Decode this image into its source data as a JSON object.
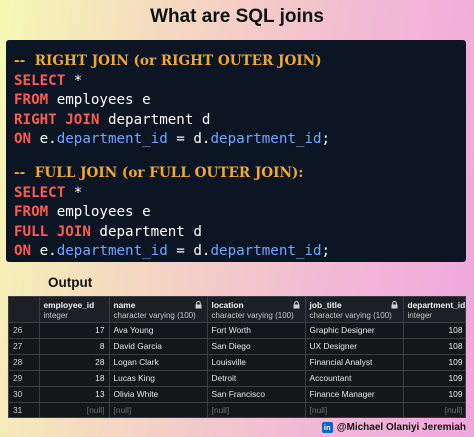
{
  "title": "What are SQL joins",
  "code": {
    "right_comment": "--  RIGHT JOIN (or RIGHT OUTER JOIN)",
    "right_select_kw": "SELECT",
    "right_select_rest": " *",
    "right_from_kw": "FROM",
    "right_from_rest": " employees e",
    "right_join_kw": "RIGHT JOIN",
    "right_join_rest": " department d",
    "right_on_kw": "ON",
    "right_on_e": " e.",
    "right_on_col1": "department_id",
    "right_on_mid": " = d.",
    "right_on_col2": "department_id",
    "right_on_end": ";",
    "full_comment": "--  FULL JOIN (or FULL OUTER JOIN):",
    "full_select_kw": "SELECT",
    "full_select_rest": " *",
    "full_from_kw": "FROM",
    "full_from_rest": " employees e",
    "full_join_kw": "FULL JOIN",
    "full_join_rest": " department d",
    "full_on_kw": "ON",
    "full_on_e": " e.",
    "full_on_col1": "department_id",
    "full_on_mid": " = d.",
    "full_on_col2": "department_id",
    "full_on_end": ";"
  },
  "output_label": "Output",
  "table": {
    "headers": [
      {
        "name": "",
        "type": ""
      },
      {
        "name": "employee_id",
        "type": "integer"
      },
      {
        "name": "name",
        "type": "character varying (100)"
      },
      {
        "name": "location",
        "type": "character varying (100)"
      },
      {
        "name": "job_title",
        "type": "character varying (100)"
      },
      {
        "name": "department_id",
        "type": "integer"
      }
    ],
    "rows": [
      {
        "row": "26",
        "employee_id": "17",
        "name": "Ava Young",
        "location": "Fort Worth",
        "job_title": "Graphic Designer",
        "department_id": "108"
      },
      {
        "row": "27",
        "employee_id": "8",
        "name": "David Garcia",
        "location": "San Diego",
        "job_title": "UX Designer",
        "department_id": "108"
      },
      {
        "row": "28",
        "employee_id": "28",
        "name": "Logan Clark",
        "location": "Louisville",
        "job_title": "Financial Analyst",
        "department_id": "109"
      },
      {
        "row": "29",
        "employee_id": "18",
        "name": "Lucas King",
        "location": "Detroit",
        "job_title": "Accountant",
        "department_id": "109"
      },
      {
        "row": "30",
        "employee_id": "13",
        "name": "Olivia White",
        "location": "San Francisco",
        "job_title": "Finance Manager",
        "department_id": "109"
      },
      {
        "row": "31",
        "employee_id": "[null]",
        "name": "[null]",
        "location": "[null]",
        "job_title": "[null]",
        "department_id": "[null]"
      }
    ]
  },
  "credit": "@Michael Olaniyi Jeremiah",
  "linkedin_icon_text": "in"
}
